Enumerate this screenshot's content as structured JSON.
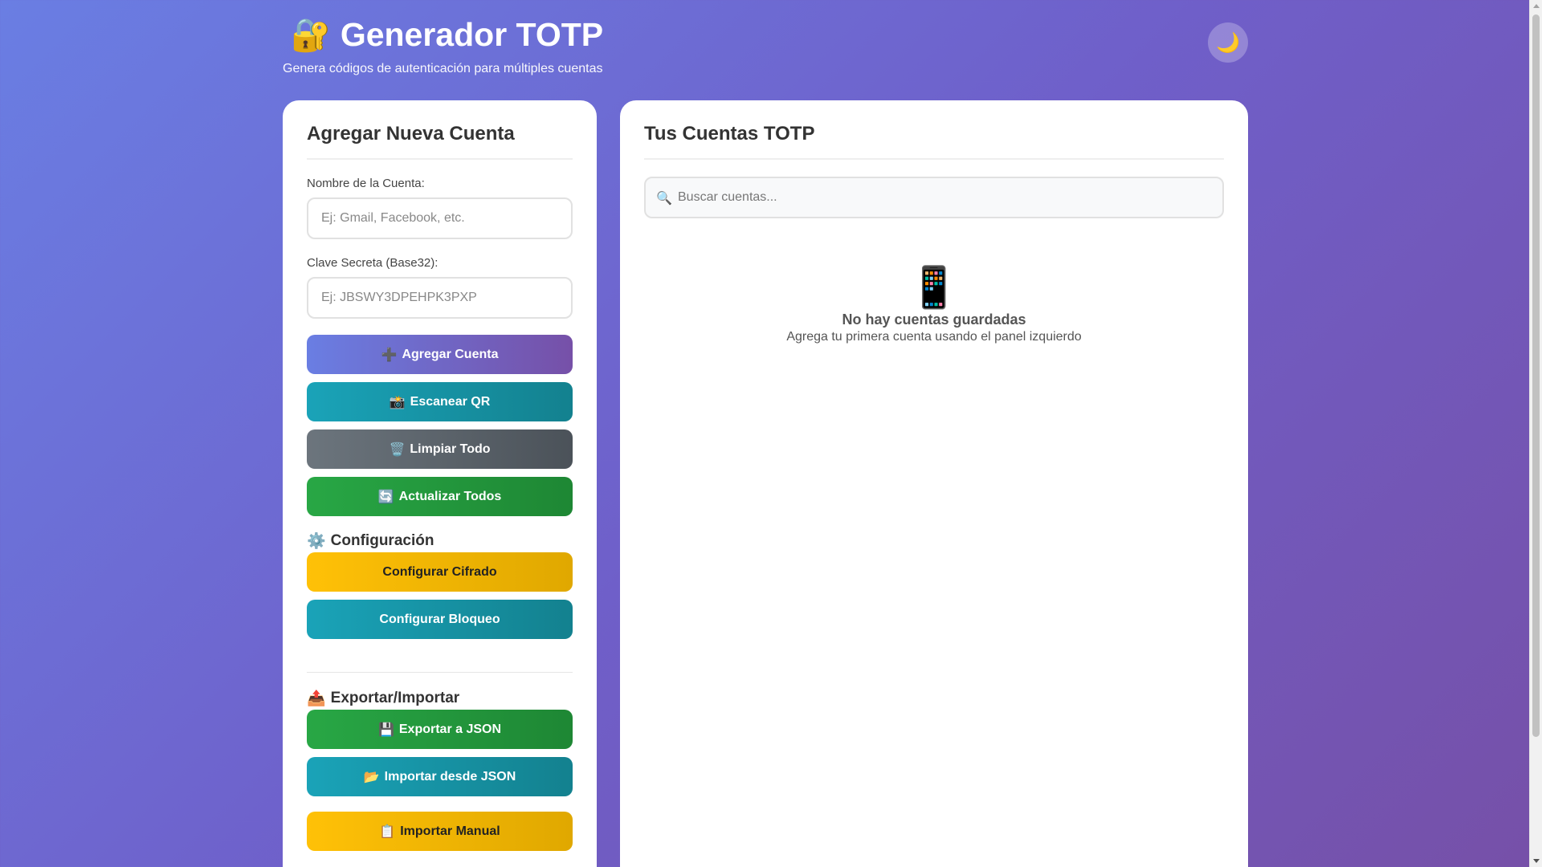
{
  "header": {
    "icon": "🔐",
    "title": "Generador TOTP",
    "subtitle": "Genera códigos de autenticación para múltiples cuentas",
    "theme_icon": "🌙"
  },
  "left_panel": {
    "title": "Agregar Nueva Cuenta",
    "account_label": "Nombre de la Cuenta:",
    "account_placeholder": "Ej: Gmail, Facebook, etc.",
    "secret_label": "Clave Secreta (Base32):",
    "secret_placeholder": "Ej: JBSWY3DPEHPK3PXP",
    "buttons": {
      "add": {
        "icon": "➕",
        "label": "Agregar Cuenta"
      },
      "scan": {
        "icon": "📸",
        "label": "Escanear QR"
      },
      "clear": {
        "icon": "🗑️",
        "label": "Limpiar Todo"
      },
      "refresh": {
        "icon": "🔄",
        "label": "Actualizar Todos"
      }
    },
    "config": {
      "icon": "⚙️",
      "title": "Configuración",
      "encryption_label": "Configurar Cifrado",
      "lock_label": "Configurar Bloqueo"
    },
    "export": {
      "icon": "📤",
      "title": "Exportar/Importar",
      "export_json": {
        "icon": "💾",
        "label": "Exportar a JSON"
      },
      "import_json": {
        "icon": "📂",
        "label": "Importar desde JSON"
      },
      "import_manual": {
        "icon": "📋",
        "label": "Importar Manual"
      }
    }
  },
  "right_panel": {
    "title": "Tus Cuentas TOTP",
    "search_placeholder": "Buscar cuentas...",
    "search_icon": "🔍",
    "empty_icon": "📱",
    "empty_title": "No hay cuentas guardadas",
    "empty_text": "Agrega tu primera cuenta usando el panel izquierdo"
  },
  "colors": {
    "primary": "#6a7ee3",
    "info": "#1aa3b8",
    "gray": "#6c757d",
    "success": "#28a745",
    "warning": "#ffc107"
  }
}
